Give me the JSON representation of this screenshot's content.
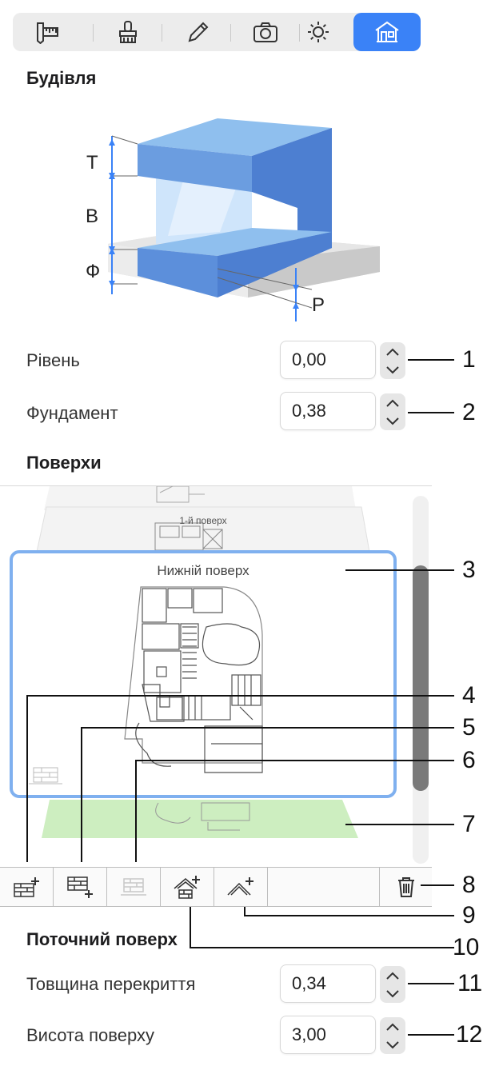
{
  "toolbar": {
    "tabs": [
      {
        "icon": "caliper-ruler-icon",
        "active": false
      },
      {
        "icon": "brush-icon",
        "active": false
      },
      {
        "icon": "pencil-icon",
        "active": false
      },
      {
        "icon": "camera-icon",
        "active": false
      },
      {
        "icon": "sun-icon",
        "active": false
      },
      {
        "icon": "building-icon",
        "active": true
      }
    ],
    "active_color": "#3a82f7"
  },
  "building": {
    "title": "Будівля",
    "diagram_labels": {
      "t": "Т",
      "b": "В",
      "f": "Ф",
      "r": "Р"
    },
    "level": {
      "label": "Рівень",
      "value": "0,00"
    },
    "foundation": {
      "label": "Фундамент",
      "value": "0,38"
    }
  },
  "floors": {
    "title": "Поверхи",
    "upper_floor_name": "1-й поверх",
    "selected_floor_name": "Нижній поверх"
  },
  "current_floor": {
    "title": "Поточний поверх",
    "slab_thickness": {
      "label": "Товщина перекриття",
      "value": "0,34"
    },
    "floor_height": {
      "label": "Висота поверху",
      "value": "3,00"
    }
  },
  "callouts": [
    "1",
    "2",
    "3",
    "4",
    "5",
    "6",
    "7",
    "8",
    "9",
    "10",
    "11",
    "12"
  ],
  "colors": {
    "accent": "#3a82f7",
    "selection_border": "#7fb0ef",
    "ground_floor": "#cdeec0",
    "scroll_thumb": "#7a7a7a"
  }
}
